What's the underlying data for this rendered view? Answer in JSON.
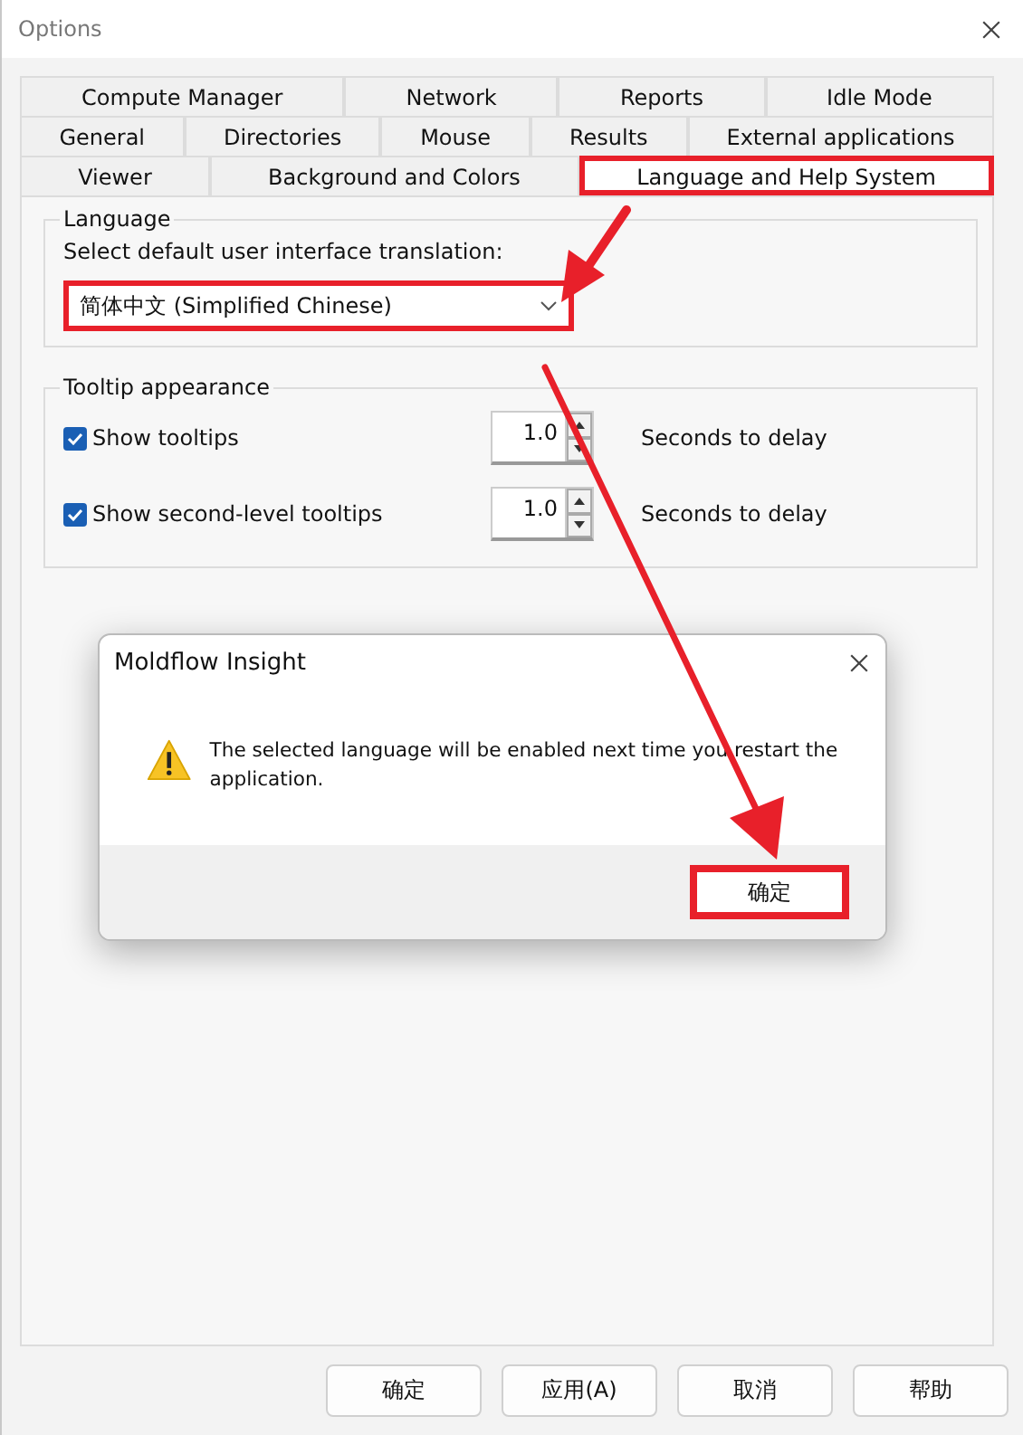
{
  "window": {
    "title": "Options"
  },
  "tab_rows": [
    [
      {
        "label": "Compute Manager",
        "selected": false,
        "highlighted": false
      },
      {
        "label": "Network",
        "selected": false,
        "highlighted": false
      },
      {
        "label": "Reports",
        "selected": false,
        "highlighted": false
      },
      {
        "label": "Idle Mode",
        "selected": false,
        "highlighted": false
      }
    ],
    [
      {
        "label": "General",
        "selected": false,
        "highlighted": false
      },
      {
        "label": "Directories",
        "selected": false,
        "highlighted": false
      },
      {
        "label": "Mouse",
        "selected": false,
        "highlighted": false
      },
      {
        "label": "Results",
        "selected": false,
        "highlighted": false
      },
      {
        "label": "External applications",
        "selected": false,
        "highlighted": false
      }
    ],
    [
      {
        "label": "Viewer",
        "selected": false,
        "highlighted": false
      },
      {
        "label": "Background and Colors",
        "selected": false,
        "highlighted": false
      },
      {
        "label": "Language and Help System",
        "selected": true,
        "highlighted": true
      }
    ]
  ],
  "language_group": {
    "title": "Language",
    "prompt": "Select default user interface translation:",
    "dropdown": {
      "value": "简体中文 (Simplified Chinese)",
      "highlighted": true
    }
  },
  "tooltip_group": {
    "title": "Tooltip appearance",
    "rows": [
      {
        "label": "Show tooltips",
        "checked": true,
        "value": "1.0",
        "unit": "Seconds to delay"
      },
      {
        "label": "Show second-level tooltips",
        "checked": true,
        "value": "1.0",
        "unit": "Seconds to delay"
      }
    ]
  },
  "dialog": {
    "title": "Moldflow Insight",
    "message": "The selected language will be enabled next time you restart the application.",
    "button": {
      "label": "确定",
      "highlighted": true
    }
  },
  "buttons": [
    "确定",
    "应用(A)",
    "取消",
    "帮助"
  ]
}
